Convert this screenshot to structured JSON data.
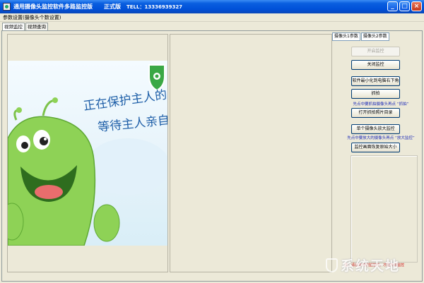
{
  "window": {
    "title": "通用摄像头监控软件多路监控版",
    "edition": "正式版",
    "phone": "TELL：13336939327",
    "controls": [
      "_",
      "□",
      "×"
    ]
  },
  "menubar": {
    "label": "参数设置(摄像头个数设置)"
  },
  "tabs": [
    {
      "label": "视频监控",
      "active": true
    },
    {
      "label": "视频查询",
      "active": false
    }
  ],
  "video": {
    "banner_line1": "正在保护主人的",
    "banner_line2": "等待主人亲自开"
  },
  "side_tabs": [
    "摄像头1参数",
    "摄像头2参数"
  ],
  "buttons": {
    "start": "开启监控",
    "stop": "关闭监控",
    "minimize": "软件最小化到电脑右下角",
    "capture": "抓拍",
    "open_dir": "打开抓拍照片目录",
    "zoom": "单个摄像头放大监控",
    "restore": "监控画面恢复原始大小"
  },
  "hints": {
    "capture_hint": "先点中要抓拍摄像头再点 “抓拍”",
    "zoom_hint": "先点中要放大的摄像头再点 “放大监控”"
  },
  "footer_note": "注：请在未开启监控时，才能开启监控",
  "watermark": "系统天地",
  "colors": {
    "title_blue": "#0050d8",
    "hint_blue": "#1f2db8",
    "note_red": "#d01010"
  }
}
